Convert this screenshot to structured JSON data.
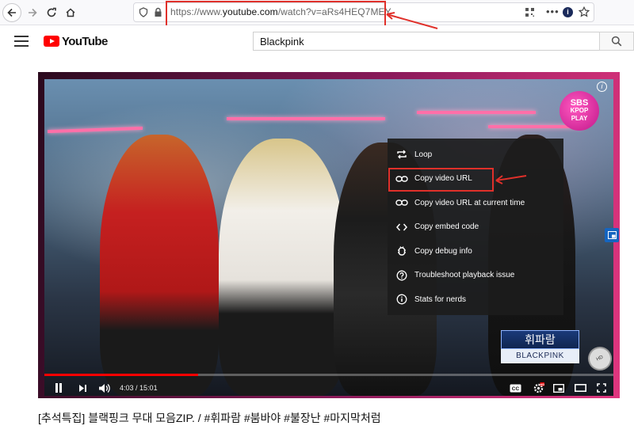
{
  "browser": {
    "url_prefix": "https://www.",
    "url_domain": "youtube.com",
    "url_rest": "/watch?v=aRs4HEQ7MEY"
  },
  "youtube": {
    "logo_text": "YouTube",
    "search_value": "Blackpink"
  },
  "player": {
    "badge_line1": "SBS",
    "badge_line2": "KPOP",
    "badge_line3": "PLAY",
    "lower_third_name": "휘파람",
    "lower_third_artist": "BLACKPINK",
    "disc_label": "HD",
    "current_time": "4:03",
    "duration": "15:01",
    "progress_fraction": 0.27
  },
  "context_menu": {
    "items": [
      {
        "label": "Loop",
        "icon": "loop-icon"
      },
      {
        "label": "Copy video URL",
        "icon": "link-icon"
      },
      {
        "label": "Copy video URL at current time",
        "icon": "link-icon"
      },
      {
        "label": "Copy embed code",
        "icon": "code-icon"
      },
      {
        "label": "Copy debug info",
        "icon": "debug-icon"
      },
      {
        "label": "Troubleshoot playback issue",
        "icon": "help-icon"
      },
      {
        "label": "Stats for nerds",
        "icon": "info-icon"
      }
    ]
  },
  "video": {
    "title": "[추석특집] 블랙핑크 무대 모음ZIP. / #휘파람 #붐바야 #불장난 #마지막처럼"
  },
  "colors": {
    "annotation_red": "#e0302a",
    "progress_red": "#ff0000",
    "yt_red": "#ff0000"
  }
}
